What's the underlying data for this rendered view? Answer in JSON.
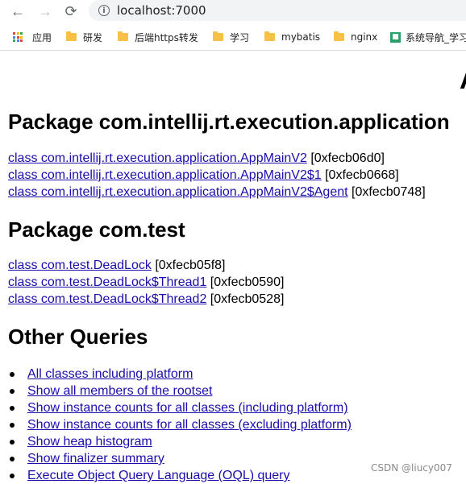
{
  "browser": {
    "url": "localhost:7000",
    "bookmarks": [
      {
        "label": "应用",
        "icon": "apps-grid-icon"
      },
      {
        "label": "研发",
        "icon": "folder-icon"
      },
      {
        "label": "后端https转发",
        "icon": "folder-icon"
      },
      {
        "label": "学习",
        "icon": "folder-icon"
      },
      {
        "label": "mybatis",
        "icon": "folder-icon"
      },
      {
        "label": "nginx",
        "icon": "folder-icon"
      },
      {
        "label": "系统导航_学习",
        "icon": "site-icon"
      }
    ]
  },
  "page": {
    "cut_title": "A",
    "sections": [
      {
        "heading": "Package com.intellij.rt.execution.application",
        "items": [
          {
            "link": "class com.intellij.rt.execution.application.AppMainV2",
            "addr": "[0xfecb06d0]"
          },
          {
            "link": "class com.intellij.rt.execution.application.AppMainV2$1",
            "addr": "[0xfecb0668]"
          },
          {
            "link": "class com.intellij.rt.execution.application.AppMainV2$Agent",
            "addr": "[0xfecb0748]"
          }
        ]
      },
      {
        "heading": "Package com.test",
        "items": [
          {
            "link": "class com.test.DeadLock",
            "addr": "[0xfecb05f8]"
          },
          {
            "link": "class com.test.DeadLock$Thread1",
            "addr": "[0xfecb0590]"
          },
          {
            "link": "class com.test.DeadLock$Thread2",
            "addr": "[0xfecb0528]"
          }
        ]
      }
    ],
    "other": {
      "heading": "Other Queries",
      "links": [
        "All classes including platform",
        "Show all members of the rootset",
        "Show instance counts for all classes (including platform)",
        "Show instance counts for all classes (excluding platform)",
        "Show heap histogram",
        "Show finalizer summary",
        "Execute Object Query Language (OQL) query"
      ]
    },
    "watermark": "CSDN @liucy007"
  }
}
